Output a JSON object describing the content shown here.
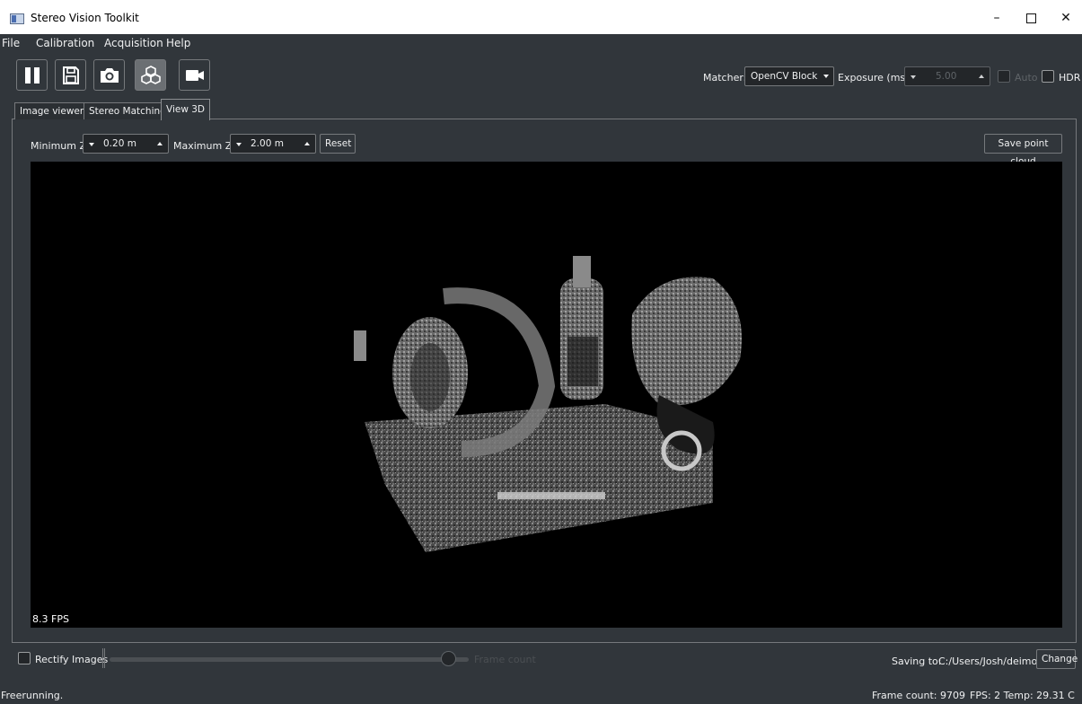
{
  "window": {
    "title": "Stereo Vision Toolkit",
    "minimize": "–",
    "close": "✕"
  },
  "menu": [
    "File",
    "Calibration",
    "Acquisition",
    "Help"
  ],
  "toolbar": {
    "buttons": [
      "pause-icon",
      "save-icon",
      "camera-icon",
      "cubes-icon",
      "video-camera-icon"
    ],
    "matcher_label": "Matcher:",
    "matcher_value": "OpenCV Block",
    "exposure_label": "Exposure (ms)",
    "exposure_value": "5.00",
    "auto_label": "Auto",
    "hdr_label": "HDR"
  },
  "tabs": [
    "Image viewer",
    "Stereo Matching",
    "View 3D"
  ],
  "active_tab": "View 3D",
  "view3d": {
    "min_z_label": "Minimum Z:",
    "min_z_value": "0.20 m",
    "max_z_label": "Maximum Z :",
    "max_z_value": "2.00 m",
    "reset_label": "Reset",
    "save_cloud_label": "Save point cloud",
    "fps_overlay": "8.3 FPS"
  },
  "bottom": {
    "rectify_label": "Rectify Images",
    "frame_count_ghost": "Frame count",
    "saving_label": "Saving to:",
    "saving_path": "C:/Users/Josh/deimos/",
    "change_label": "Change"
  },
  "status": {
    "mode": "Freerunning.",
    "frame_count": "Frame count: 9709",
    "fps_temp": "FPS: 2  Temp: 29.31 C"
  },
  "colors": {
    "background": "#31363b",
    "field": "#232629",
    "border": "#76797c",
    "text": "#eff0f1",
    "viewer": "#000000"
  }
}
